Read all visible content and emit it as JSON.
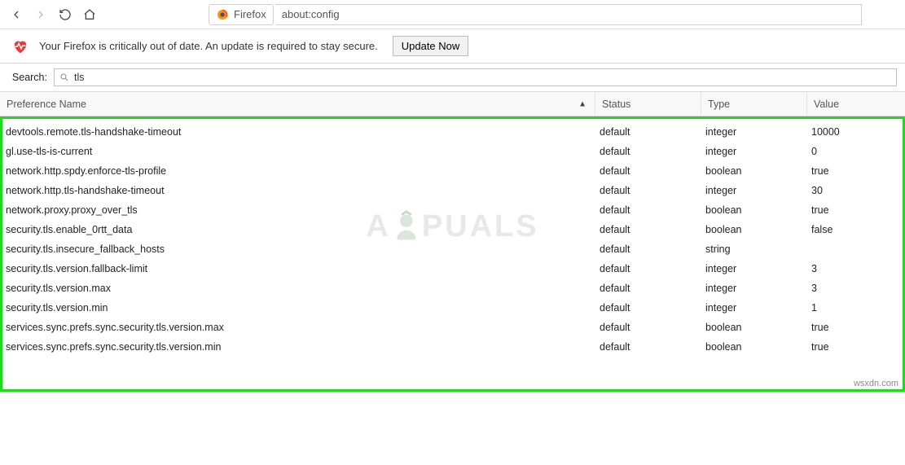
{
  "toolbar": {
    "tab_label": "Firefox",
    "address": "about:config"
  },
  "warning": {
    "message": "Your Firefox is critically out of date. An update is required to stay secure.",
    "button_label": "Update Now"
  },
  "search": {
    "label": "Search:",
    "value": "tls"
  },
  "table": {
    "headers": {
      "name": "Preference Name",
      "status": "Status",
      "type": "Type",
      "value": "Value"
    },
    "rows": [
      {
        "name": "devtools.remote.tls-handshake-timeout",
        "status": "default",
        "type": "integer",
        "value": "10000"
      },
      {
        "name": "gl.use-tls-is-current",
        "status": "default",
        "type": "integer",
        "value": "0"
      },
      {
        "name": "network.http.spdy.enforce-tls-profile",
        "status": "default",
        "type": "boolean",
        "value": "true"
      },
      {
        "name": "network.http.tls-handshake-timeout",
        "status": "default",
        "type": "integer",
        "value": "30"
      },
      {
        "name": "network.proxy.proxy_over_tls",
        "status": "default",
        "type": "boolean",
        "value": "true"
      },
      {
        "name": "security.tls.enable_0rtt_data",
        "status": "default",
        "type": "boolean",
        "value": "false"
      },
      {
        "name": "security.tls.insecure_fallback_hosts",
        "status": "default",
        "type": "string",
        "value": ""
      },
      {
        "name": "security.tls.version.fallback-limit",
        "status": "default",
        "type": "integer",
        "value": "3"
      },
      {
        "name": "security.tls.version.max",
        "status": "default",
        "type": "integer",
        "value": "3"
      },
      {
        "name": "security.tls.version.min",
        "status": "default",
        "type": "integer",
        "value": "1"
      },
      {
        "name": "services.sync.prefs.sync.security.tls.version.max",
        "status": "default",
        "type": "boolean",
        "value": "true"
      },
      {
        "name": "services.sync.prefs.sync.security.tls.version.min",
        "status": "default",
        "type": "boolean",
        "value": "true"
      }
    ]
  },
  "watermark": {
    "prefix": "A",
    "suffix": "PUALS"
  },
  "credit": "wsxdn.com"
}
